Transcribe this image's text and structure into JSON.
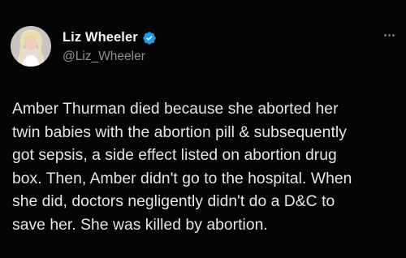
{
  "tweet": {
    "author": {
      "display_name": "Liz Wheeler",
      "handle": "@Liz_Wheeler",
      "verified": true,
      "avatar_icon": "profile-photo"
    },
    "more_icon": "ellipsis-icon",
    "text": "Amber Thurman died because she aborted her\ntwin babies with the abortion pill & subsequently\ngot sepsis, a side effect listed on abortion drug\nbox. Then, Amber didn't go to the hospital. When\nshe did, doctors negligently didn't do a D&C to\nsave her. She was killed by abortion."
  },
  "colors": {
    "background": "#000000",
    "text": "#e7e9ea",
    "secondary_text": "#8b9096",
    "verified_badge": "#1d9bf0"
  }
}
